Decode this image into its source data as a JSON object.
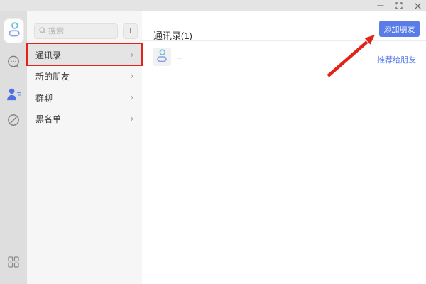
{
  "titlebar": {
    "controls": [
      {
        "name": "minimize"
      },
      {
        "name": "restore"
      },
      {
        "name": "close"
      }
    ]
  },
  "sidebar": {
    "icons": [
      {
        "name": "profile-avatar-icon"
      },
      {
        "name": "chat-messages-icon"
      },
      {
        "name": "contacts-icon",
        "active": true
      },
      {
        "name": "discover-icon"
      },
      {
        "name": "apps-grid-icon"
      }
    ]
  },
  "panel": {
    "search_placeholder": "搜索",
    "add_label": "+",
    "chevron": "›",
    "items": [
      {
        "label": "通讯录",
        "selected": true
      },
      {
        "label": "新的朋友",
        "selected": false
      },
      {
        "label": "群聊",
        "selected": false
      },
      {
        "label": "黑名单",
        "selected": false
      }
    ]
  },
  "main": {
    "title": "通讯录(1)",
    "add_friend_label": "添加朋友",
    "contact_action": "推荐给朋友"
  },
  "annotations": {
    "red_box_around": "通讯录",
    "arrow_points_to": "添加朋友"
  },
  "colors": {
    "accent_blue": "#5a7ce8",
    "annotation_red": "#e02419",
    "active_icon_blue": "#4d6fe3"
  }
}
